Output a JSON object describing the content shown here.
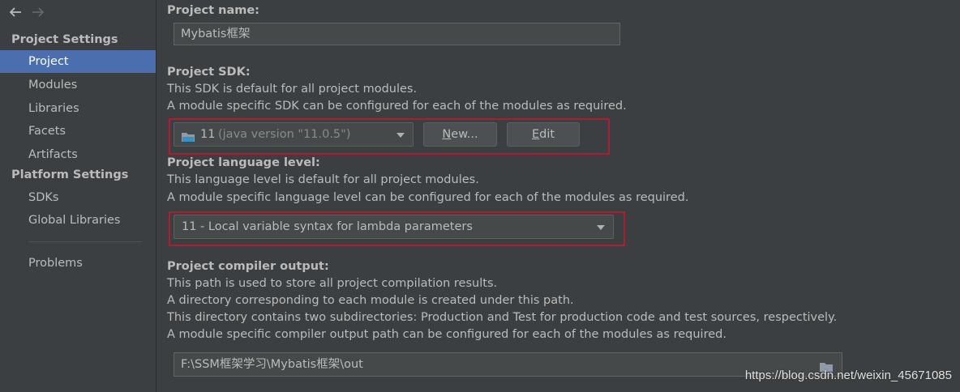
{
  "sidebar": {
    "project_settings_header": "Project Settings",
    "platform_settings_header": "Platform Settings",
    "project_items": [
      {
        "label": "Project"
      },
      {
        "label": "Modules"
      },
      {
        "label": "Libraries"
      },
      {
        "label": "Facets"
      },
      {
        "label": "Artifacts"
      }
    ],
    "platform_items": [
      {
        "label": "SDKs"
      },
      {
        "label": "Global Libraries"
      }
    ],
    "problems_label": "Problems"
  },
  "project_name": {
    "label": "Project name:",
    "value": "Mybatis框架"
  },
  "project_sdk": {
    "label": "Project SDK:",
    "desc1": "This SDK is default for all project modules.",
    "desc2": "A module specific SDK can be configured for each of the modules as required.",
    "selected_version": "11",
    "selected_detail": "(java version \"11.0.5\")",
    "new_button_mnemonic": "N",
    "new_button_rest": "ew...",
    "edit_button_mnemonic": "E",
    "edit_button_rest": "dit"
  },
  "language_level": {
    "label": "Project language level:",
    "desc1": "This language level is default for all project modules.",
    "desc2": "A module specific language level can be configured for each of the modules as required.",
    "selected": "11 - Local variable syntax for lambda parameters"
  },
  "compiler_output": {
    "label": "Project compiler output:",
    "desc1": "This path is used to store all project compilation results.",
    "desc2": "A directory corresponding to each module is created under this path.",
    "desc3": "This directory contains two subdirectories: Production and Test for production code and test sources, respectively.",
    "desc4": "A module specific compiler output path can be configured for each of the modules as required.",
    "path": "F:\\SSM框架学习\\Mybatis框架\\out"
  },
  "watermark": "https://blog.csdn.net/weixin_45671085",
  "colors": {
    "background": "#3c3f41",
    "selection": "#4b6eaf",
    "highlight_border": "#b01d2e"
  }
}
